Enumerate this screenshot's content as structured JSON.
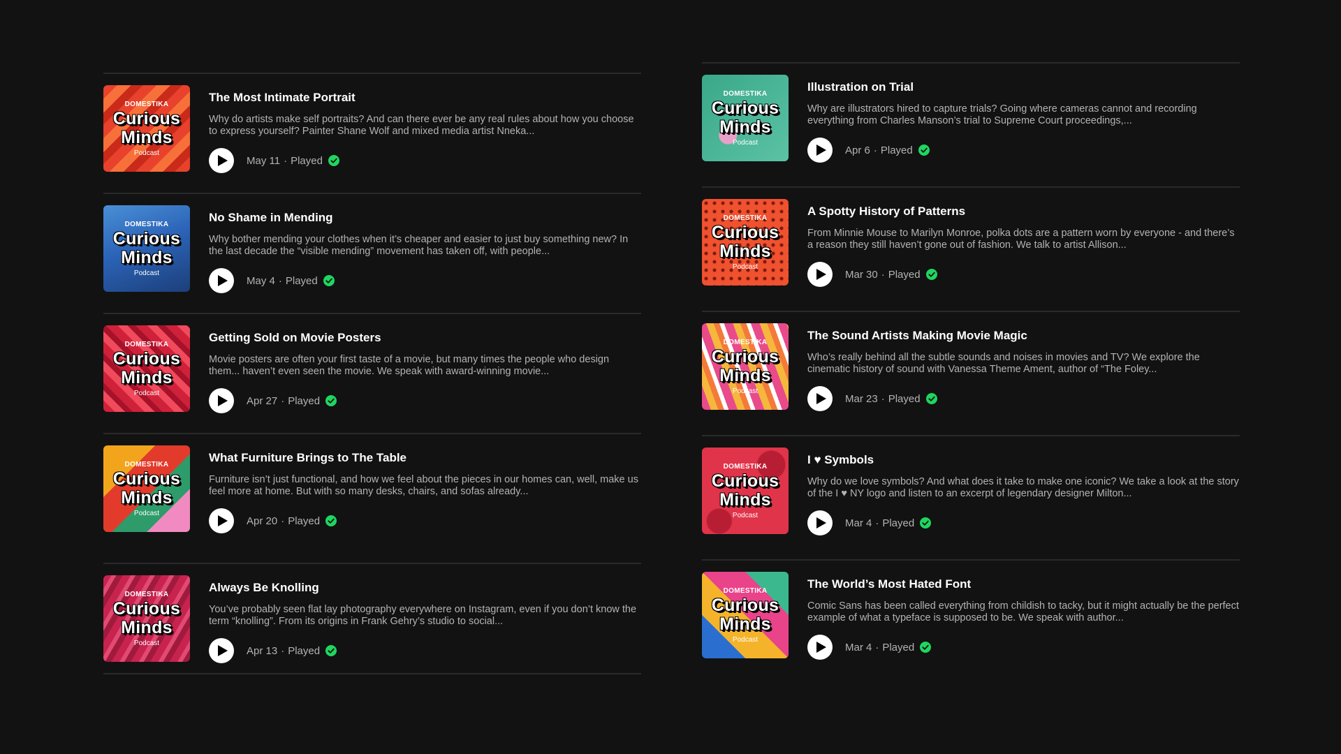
{
  "cover": {
    "brand": "DOMESTIKA",
    "line1": "Curious",
    "line2": "Minds",
    "sub": "Podcast"
  },
  "colors": {
    "background": "#121212",
    "played_check": "#1ed760",
    "secondary_text": "#b3b3b3"
  },
  "icons": {
    "play": "play-icon",
    "played": "check-circle-icon"
  },
  "left_episodes": [
    {
      "title": "The Most Intimate Portrait",
      "description": "Why do artists make self portraits? And can there ever be any real rules about how you choose to express yourself? Painter Shane Wolf and mixed media artist Nneka...",
      "date": "May 11",
      "status": "Played",
      "cover_colors": [
        "#e8412c",
        "#f7703a",
        "#c92a1a"
      ]
    },
    {
      "title": "No Shame in Mending",
      "description": "Why bother mending your clothes when it’s cheaper and easier to just buy something new? In the last decade the “visible mending” movement has taken off, with people...",
      "date": "May 4",
      "status": "Played",
      "cover_colors": [
        "#2c64b8",
        "#4a8fd6",
        "#1c3f7a"
      ]
    },
    {
      "title": "Getting Sold on Movie Posters",
      "description": "Movie posters are often your first taste of a movie, but many times the people who design them... haven’t even seen the movie. We speak with award-winning movie...",
      "date": "Apr 27",
      "status": "Played",
      "cover_colors": [
        "#d0213a",
        "#f04a5c",
        "#a5122a"
      ]
    },
    {
      "title": "What Furniture Brings to The Table",
      "description": "Furniture isn’t just functional, and how we feel about the pieces in our homes can, well, make us feel more at home. But with so many desks, chairs, and sofas already...",
      "date": "Apr 20",
      "status": "Played",
      "cover_colors": [
        "#f2a51c",
        "#e23b2b",
        "#2e9b6a",
        "#f08ac0"
      ]
    },
    {
      "title": "Always Be Knolling",
      "description": "You’ve probably seen flat lay photography everywhere on Instagram, even if you don’t know the term “knolling”. From its origins in Frank Gehry’s studio to social...",
      "date": "Apr 13",
      "status": "Played",
      "cover_colors": [
        "#c8234f",
        "#e14a73",
        "#a01a3e"
      ]
    }
  ],
  "right_episodes": [
    {
      "title": "Illustration on Trial",
      "description": "Why are illustrators hired to capture trials? Going where cameras cannot and recording everything from Charles Manson’s trial to Supreme Court proceedings,...",
      "date": "Apr 6",
      "status": "Played",
      "cover_colors": [
        "#3aa88a",
        "#5cc2a4",
        "#e8a0c8"
      ]
    },
    {
      "title": "A Spotty History of Patterns",
      "description": "From Minnie Mouse to Marilyn Monroe, polka dots are a pattern worn by everyone - and there’s a reason they still haven’t gone out of fashion. We talk to artist Allison...",
      "date": "Mar 30",
      "status": "Played",
      "cover_colors": [
        "#f0512f",
        "#d8321c",
        "#7a1b10"
      ]
    },
    {
      "title": "The Sound Artists Making Movie Magic",
      "description": "Who’s really behind all the subtle sounds and noises in movies and TV? We explore the cinematic history of sound with Vanessa Theme Ament, author of “The Foley...",
      "date": "Mar 23",
      "status": "Played",
      "cover_colors": [
        "#e94b8a",
        "#f5b83d",
        "#f47a3a",
        "#ffffff"
      ]
    },
    {
      "title": "I ♥ Symbols",
      "description": "Why do we love symbols? And what does it take to make one iconic? We take a look at the story of the I ♥ NY logo and listen to an excerpt of legendary designer Milton...",
      "date": "Mar 4",
      "status": "Played",
      "cover_colors": [
        "#e0344a",
        "#f25a6a",
        "#b81e33"
      ]
    },
    {
      "title": "The World’s Most Hated Font",
      "description": "Comic Sans has been called everything from childish to tacky, but it might actually be the perfect example of what a typeface is supposed to be. We speak with author...",
      "date": "Mar 4",
      "status": "Played",
      "cover_colors": [
        "#2a6fd0",
        "#f4b32a",
        "#e9438a",
        "#3cb88f"
      ]
    }
  ]
}
